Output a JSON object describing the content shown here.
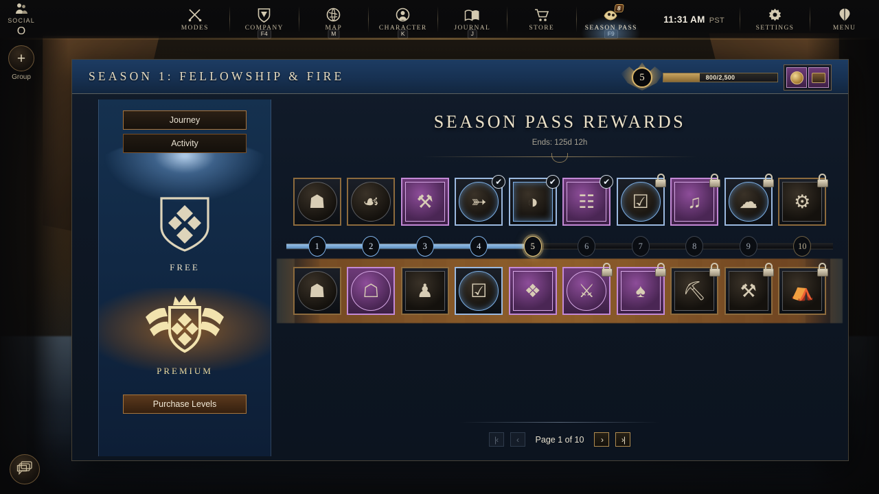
{
  "topbar": {
    "social": {
      "label": "SOCIAL",
      "key": "O",
      "icon": "social-icon"
    },
    "group": {
      "label": "Group",
      "icon": "plus-icon"
    },
    "chat": {
      "icon": "chat-icon"
    },
    "items": [
      {
        "label": "MODES",
        "key": "",
        "icon": "crossed-swords-icon",
        "active": false,
        "badge": ""
      },
      {
        "label": "COMPANY",
        "key": "F4",
        "icon": "shield-icon",
        "active": false,
        "badge": ""
      },
      {
        "label": "MAP",
        "key": "M",
        "icon": "globe-icon",
        "active": false,
        "badge": ""
      },
      {
        "label": "CHARACTER",
        "key": "K",
        "icon": "person-icon",
        "active": false,
        "badge": ""
      },
      {
        "label": "JOURNAL",
        "key": "J",
        "icon": "book-icon",
        "active": false,
        "badge": ""
      },
      {
        "label": "STORE",
        "key": "",
        "icon": "cart-icon",
        "active": false,
        "badge": ""
      },
      {
        "label": "SEASON PASS",
        "key": "F9",
        "icon": "season-pass-icon",
        "active": true,
        "badge": "8"
      }
    ],
    "clock": {
      "time": "11:31 AM",
      "zone": "PST"
    },
    "right_items": [
      {
        "label": "SETTINGS",
        "icon": "gear-icon"
      },
      {
        "label": "MENU",
        "icon": "menu-icon"
      }
    ]
  },
  "panel": {
    "title": "SEASON 1: FELLOWSHIP & FIRE",
    "level": "5",
    "xp": "800/2,500",
    "xp_percent": 32,
    "currencies": [
      {
        "name": "seasonal-token",
        "icon": "coin-icon"
      },
      {
        "name": "seasonal-cache",
        "icon": "chest-icon"
      }
    ]
  },
  "sidebar": {
    "tabs": [
      {
        "label": "Journey",
        "active": true
      },
      {
        "label": "Activity",
        "active": false
      }
    ],
    "free_label": "FREE",
    "premium_label": "PREMIUM",
    "purchase_label": "Purchase Levels"
  },
  "main": {
    "title": "SEASON PASS REWARDS",
    "subtitle": "Ends: 125d 12h"
  },
  "levels": [
    {
      "number": "1",
      "state": "done"
    },
    {
      "number": "2",
      "state": "done"
    },
    {
      "number": "3",
      "state": "done"
    },
    {
      "number": "4",
      "state": "done"
    },
    {
      "number": "5",
      "state": "current"
    },
    {
      "number": "6",
      "state": "locked"
    },
    {
      "number": "7",
      "state": "locked"
    },
    {
      "number": "8",
      "state": "locked"
    },
    {
      "number": "9",
      "state": "locked"
    },
    {
      "number": "10",
      "state": "last"
    }
  ],
  "free_rewards": [
    {
      "name": "dark-chest",
      "glyph": "☗",
      "rarity": "common",
      "shape": "round",
      "status": "available"
    },
    {
      "name": "food-platter",
      "glyph": "☙",
      "rarity": "common",
      "shape": "round",
      "status": "available"
    },
    {
      "name": "crossed-tools-coin",
      "glyph": "⚒",
      "rarity": "epic",
      "shape": "square",
      "status": "available"
    },
    {
      "name": "arrow-bundle",
      "glyph": "➳",
      "rarity": "rare",
      "shape": "round",
      "status": "claimed"
    },
    {
      "name": "bread-loaves",
      "glyph": "◑",
      "rarity": "rare",
      "shape": "square",
      "status": "claimed"
    },
    {
      "name": "scroll-coin",
      "glyph": "☷",
      "rarity": "epic",
      "shape": "square",
      "status": "claimed"
    },
    {
      "name": "repair-chest",
      "glyph": "☑",
      "rarity": "rare",
      "shape": "round",
      "status": "locked"
    },
    {
      "name": "horn-coin",
      "glyph": "♫",
      "rarity": "epic",
      "shape": "square",
      "status": "locked"
    },
    {
      "name": "cloth-bundle",
      "glyph": "☁",
      "rarity": "rare",
      "shape": "round",
      "status": "locked"
    },
    {
      "name": "leg-armor",
      "glyph": "⚙",
      "rarity": "common",
      "shape": "square",
      "status": "locked"
    }
  ],
  "premium_rewards": [
    {
      "name": "supply-chest",
      "glyph": "☗",
      "rarity": "common",
      "shape": "round",
      "status": "available"
    },
    {
      "name": "epic-chest",
      "glyph": "☖",
      "rarity": "epic",
      "shape": "round",
      "status": "available"
    },
    {
      "name": "emote-torch",
      "glyph": "♟",
      "rarity": "common",
      "shape": "square",
      "status": "available"
    },
    {
      "name": "repair-kit-chest",
      "glyph": "☑",
      "rarity": "rare",
      "shape": "round",
      "status": "available"
    },
    {
      "name": "gold-nuggets",
      "glyph": "❖",
      "rarity": "epic",
      "shape": "square",
      "status": "available"
    },
    {
      "name": "weapon-chest",
      "glyph": "⚔",
      "rarity": "epic",
      "shape": "round",
      "status": "locked"
    },
    {
      "name": "emote-banner",
      "glyph": "♠",
      "rarity": "epic",
      "shape": "square",
      "status": "locked"
    },
    {
      "name": "pickaxe",
      "glyph": "⛏",
      "rarity": "common",
      "shape": "square",
      "status": "locked"
    },
    {
      "name": "war-hammer",
      "glyph": "⚒",
      "rarity": "common",
      "shape": "square",
      "status": "locked"
    },
    {
      "name": "housing-item",
      "glyph": "⛺",
      "rarity": "common",
      "shape": "square",
      "status": "locked"
    }
  ],
  "pager": {
    "first_label": "|‹",
    "prev_label": "‹",
    "next_label": "›",
    "last_label": "›|",
    "info": "Page 1 of 10",
    "first_enabled": false,
    "prev_enabled": false,
    "next_enabled": true,
    "last_enabled": true
  },
  "colors": {
    "gold": "#d8b469",
    "rare": "#7fb2e8",
    "epic": "#c389d6",
    "panel_blue": "#12263f"
  }
}
